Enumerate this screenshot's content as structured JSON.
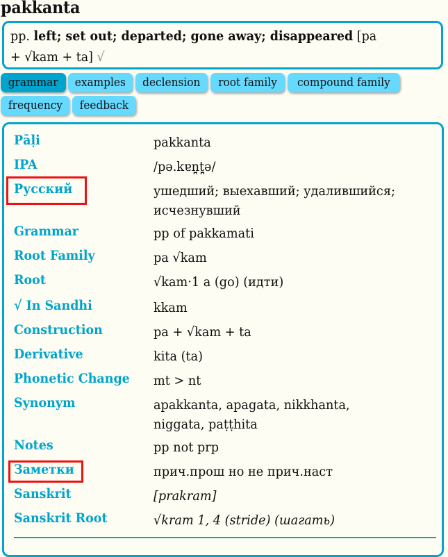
{
  "headword": "pakkanta",
  "summary": {
    "pos": "pp.",
    "meaning": "left; set out; departed; gone away; disappeared",
    "construction_line1": "[pa",
    "construction_line2": "+ √kam + ta]",
    "root_symbol": "√"
  },
  "tabs": [
    {
      "label": "grammar",
      "active": true
    },
    {
      "label": "examples",
      "active": false
    },
    {
      "label": "declension",
      "active": false
    },
    {
      "label": "root family",
      "active": false
    },
    {
      "label": "compound family",
      "active": false
    },
    {
      "label": "frequency",
      "active": false
    },
    {
      "label": "feedback",
      "active": false
    }
  ],
  "grammar": [
    {
      "label": "Pāḷi",
      "value": "pakkanta"
    },
    {
      "label": "IPA",
      "value": "/pə.kɐn̪t̪ə/"
    },
    {
      "label": "Русский",
      "value": "ушедший; выехавший; удалившийся;",
      "value2": "исчезнувший",
      "highlighted": true
    },
    {
      "label": "Grammar",
      "value": "pp of pakkamati"
    },
    {
      "label": "Root Family",
      "value": "pa √kam"
    },
    {
      "label": "Root",
      "value": "√kam·1 a (go) (идти)"
    },
    {
      "label": "√ In Sandhi",
      "value": "kkam"
    },
    {
      "label": "Construction",
      "value": "pa + √kam + ta"
    },
    {
      "label": "Derivative",
      "value": "kita (ta)"
    },
    {
      "label": "Phonetic Change",
      "value": "mt > nt"
    },
    {
      "label": "Synonym",
      "value": "apakkanta, apagata, nikkhanta,",
      "value2": "niggata, paṭṭhita"
    },
    {
      "label": "Notes",
      "value": "pp not prp"
    },
    {
      "label": "Заметки",
      "value": "прич.прош но не прич.наст",
      "highlighted": true
    },
    {
      "label": "Sanskrit",
      "value": "[prakram]",
      "italic": true
    },
    {
      "label": "Sanskrit Root",
      "value": "√kram 1, 4 (stride) (шагать)",
      "italic": true
    }
  ],
  "colors": {
    "accent": "#00a4cc",
    "tab": "#66d9ff",
    "tab_active": "#00a4cc",
    "highlight_box": "#ee1111",
    "background": "#fdfdf3"
  }
}
